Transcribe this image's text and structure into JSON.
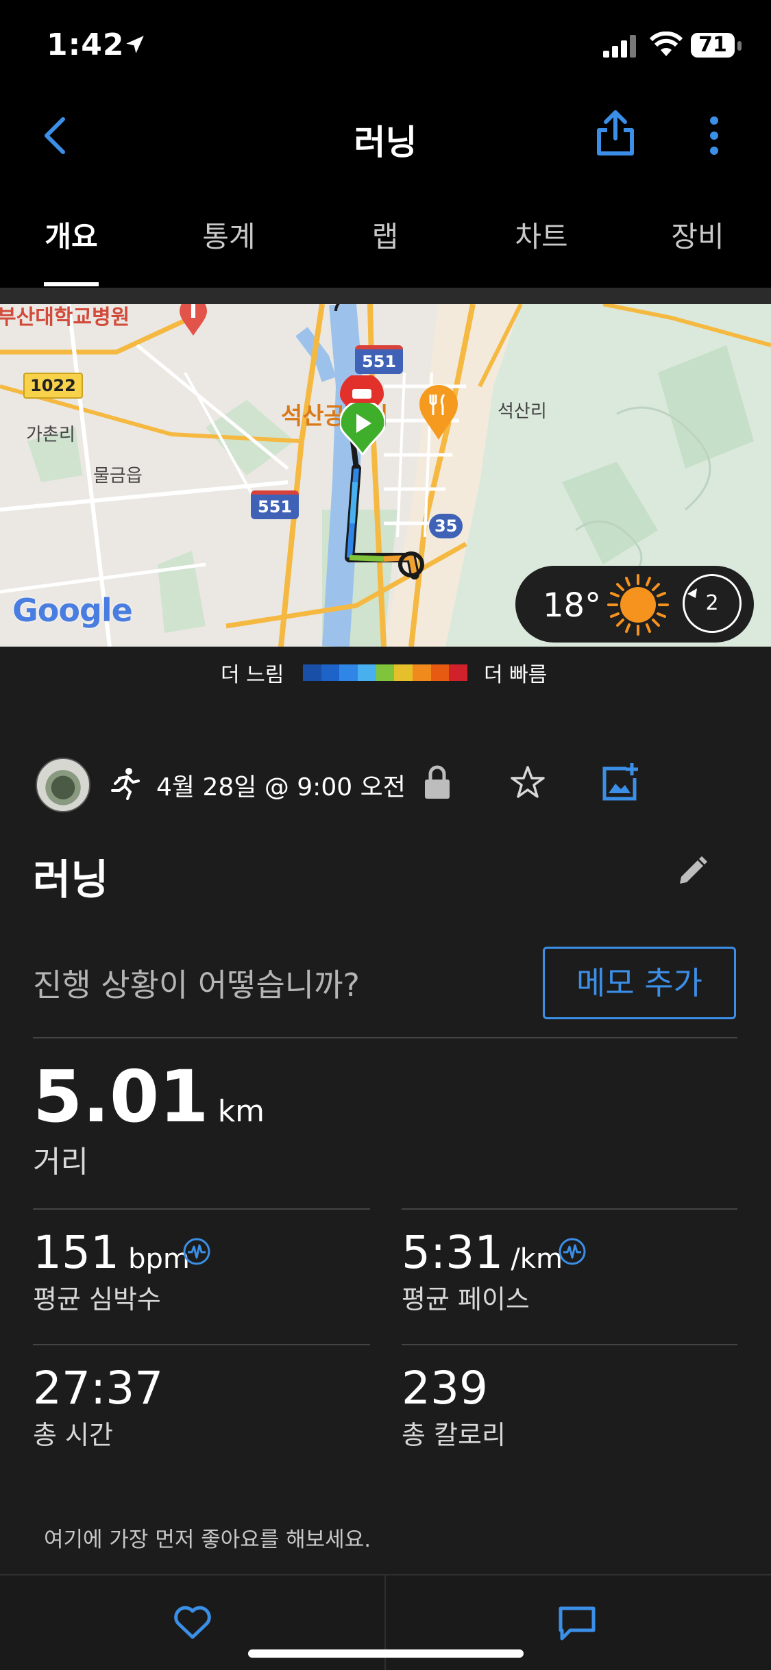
{
  "status": {
    "time": "1:42",
    "battery": "71"
  },
  "header": {
    "title": "러닝"
  },
  "tabs": [
    {
      "label": "개요",
      "active": true
    },
    {
      "label": "통계"
    },
    {
      "label": "랩"
    },
    {
      "label": "차트"
    },
    {
      "label": "장비"
    }
  ],
  "map": {
    "labels": {
      "hospital": "부산대학교병원",
      "road_1022": "1022",
      "gachon": "가촌리",
      "mulgeum": "물금읍",
      "route_551_top": "551",
      "route_551_left": "551",
      "route_35": "35",
      "seoksan_place": "석산공원기",
      "seoksan": "석산리",
      "google": "Google"
    },
    "weather": {
      "temperature": "18°",
      "wind": "2"
    }
  },
  "pace_legend": {
    "slow": "더 느림",
    "fast": "더 빠름",
    "colors": [
      "#1a4fa8",
      "#1e64c8",
      "#2f86e6",
      "#49b0f0",
      "#7fc43a",
      "#e6c02a",
      "#f08a1c",
      "#e65a12",
      "#d1212a"
    ]
  },
  "activity": {
    "date": "4월 28일 @ 9:00 오전",
    "title": "러닝",
    "memo_prompt": "진행 상황이 어떻습니까?",
    "memo_button": "메모 추가"
  },
  "stats": {
    "distance": {
      "value": "5.01",
      "unit": "km",
      "label": "거리"
    },
    "heart_rate": {
      "value": "151",
      "unit": "bpm",
      "label": "평균 심박수"
    },
    "pace": {
      "value": "5:31",
      "unit": "/km",
      "label": "평균 페이스"
    },
    "time": {
      "value": "27:37",
      "label": "총 시간"
    },
    "calories": {
      "value": "239",
      "label": "총 칼로리"
    }
  },
  "like_prompt": "여기에 가장 먼저 좋아요를 해보세요.",
  "colors": {
    "accent": "#3b8fe6",
    "background": "#1c1c1d"
  }
}
